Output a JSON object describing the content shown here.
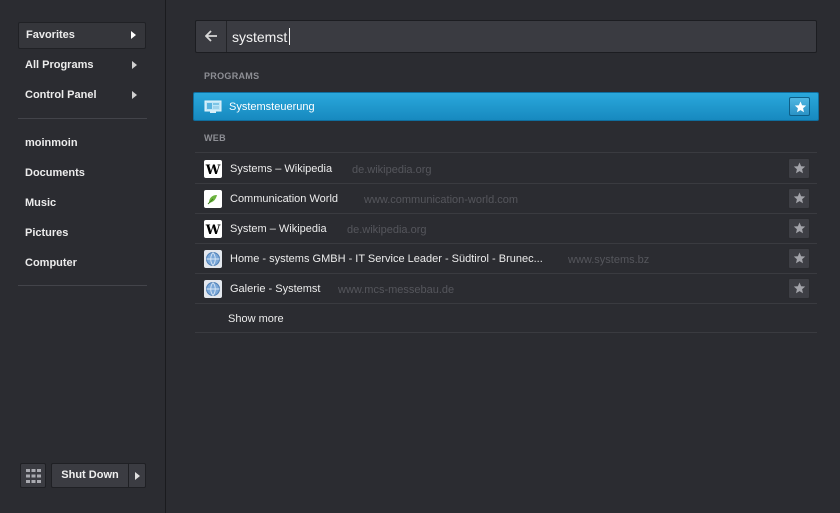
{
  "sidebar": {
    "menu": [
      {
        "label": "Favorites"
      },
      {
        "label": "All Programs"
      },
      {
        "label": "Control Panel"
      }
    ],
    "places": [
      {
        "label": "moinmoin"
      },
      {
        "label": "Documents"
      },
      {
        "label": "Music"
      },
      {
        "label": "Pictures"
      },
      {
        "label": "Computer"
      }
    ],
    "shutdown_label": "Shut Down"
  },
  "search": {
    "value": "systemst"
  },
  "programs": {
    "section_label": "PROGRAMS",
    "items": [
      {
        "label": "Systemsteuerung",
        "icon": "control-panel-icon"
      }
    ]
  },
  "web": {
    "section_label": "WEB",
    "items": [
      {
        "title": "Systems – Wikipedia",
        "url": "de.wikipedia.org",
        "icon": "wikipedia-icon"
      },
      {
        "title": "Communication World",
        "url": "www.communication-world.com",
        "icon": "site-favicon-icon"
      },
      {
        "title": "System – Wikipedia",
        "url": "de.wikipedia.org",
        "icon": "wikipedia-icon"
      },
      {
        "title": "Home - systems GMBH - IT Service Leader - Südtirol - Brunec...",
        "url": "www.systems.bz",
        "icon": "globe-icon"
      },
      {
        "title": "Galerie - Systemst",
        "url": "www.mcs-messebau.de",
        "icon": "globe-icon"
      }
    ],
    "show_more_label": "Show more"
  },
  "colors": {
    "background": "#2b2c31",
    "accent": "#1e97cf"
  }
}
